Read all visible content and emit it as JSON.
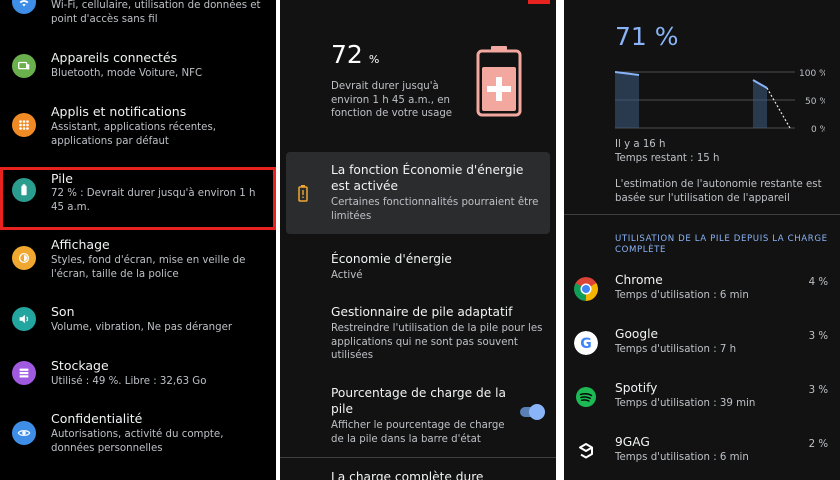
{
  "settings": {
    "items": [
      {
        "title": "",
        "sub": "Wi-Fi, cellulaire, utilisation de données et point d'accès sans fil",
        "icon": "wifi-icon",
        "color": "#3e8ee8"
      },
      {
        "title": "Appareils connectés",
        "sub": "Bluetooth, mode Voiture, NFC",
        "icon": "devices-icon",
        "color": "#6ab04c"
      },
      {
        "title": "Applis et notifications",
        "sub": "Assistant, applications récentes, applications par défaut",
        "icon": "apps-icon",
        "color": "#f08a24"
      },
      {
        "title": "Pile",
        "sub": "72 % : Devrait durer jusqu'à environ 1 h 45 a.m.",
        "icon": "battery-icon",
        "color": "#2a9d8f"
      },
      {
        "title": "Affichage",
        "sub": "Styles, fond d'écran, mise en veille de l'écran, taille de la police",
        "icon": "brightness-icon",
        "color": "#f0a830"
      },
      {
        "title": "Son",
        "sub": "Volume, vibration, Ne pas déranger",
        "icon": "volume-icon",
        "color": "#23a6a0"
      },
      {
        "title": "Stockage",
        "sub": "Utilisé : 49 %. Libre : 32,63 Go",
        "icon": "storage-icon",
        "color": "#a05ae0"
      },
      {
        "title": "Confidentialité",
        "sub": "Autorisations, activité du compte, données personnelles",
        "icon": "privacy-icon",
        "color": "#3e8ee8"
      }
    ]
  },
  "battery": {
    "percent": "72",
    "unit": "%",
    "description": "Devrait durer jusqu'à environ 1 h 45 a.m., en fonction de votre usage",
    "saver_card": {
      "title": "La fonction Économie d'énergie est activée",
      "sub": "Certaines fonctionnalités pourraient être limitées"
    },
    "options": [
      {
        "title": "Économie d'énergie",
        "sub": "Activé"
      },
      {
        "title": "Gestionnaire de pile adaptatif",
        "sub": "Restreindre l'utilisation de la pile pour les applications qui ne sont pas souvent utilisées"
      },
      {
        "title": "Pourcentage de charge de la pile",
        "sub": "Afficher le pourcentage de charge de la pile dans la barre d'état"
      },
      {
        "title": "La charge complète dure",
        "sub": ""
      }
    ],
    "toggle_on": true
  },
  "detail": {
    "percent": "71 %",
    "axis_labels": [
      "100 %",
      "50 %",
      "0 %"
    ],
    "since": "Il y a 16 h",
    "remaining": "Temps restant : 15 h",
    "estimate_note": "L'estimation de l'autonomie restante est basée sur l'utilisation de l'appareil",
    "usage_header": "UTILISATION DE LA PILE DEPUIS LA CHARGE COMPLÈTE",
    "apps": [
      {
        "name": "Chrome",
        "time": "Temps d'utilisation : 6 min",
        "pct": "4 %",
        "icon": "chrome-icon"
      },
      {
        "name": "Google",
        "time": "Temps d'utilisation : 7 h",
        "pct": "3 %",
        "icon": "google-icon"
      },
      {
        "name": "Spotify",
        "time": "Temps d'utilisation : 39 min",
        "pct": "3 %",
        "icon": "spotify-icon"
      },
      {
        "name": "9GAG",
        "time": "Temps d'utilisation : 6 min",
        "pct": "2 %",
        "icon": "9gag-icon"
      }
    ]
  },
  "colors": {
    "accent": "#8ab4f8",
    "highlight": "#e8231f",
    "battery_illustration": "#f2a79f"
  }
}
